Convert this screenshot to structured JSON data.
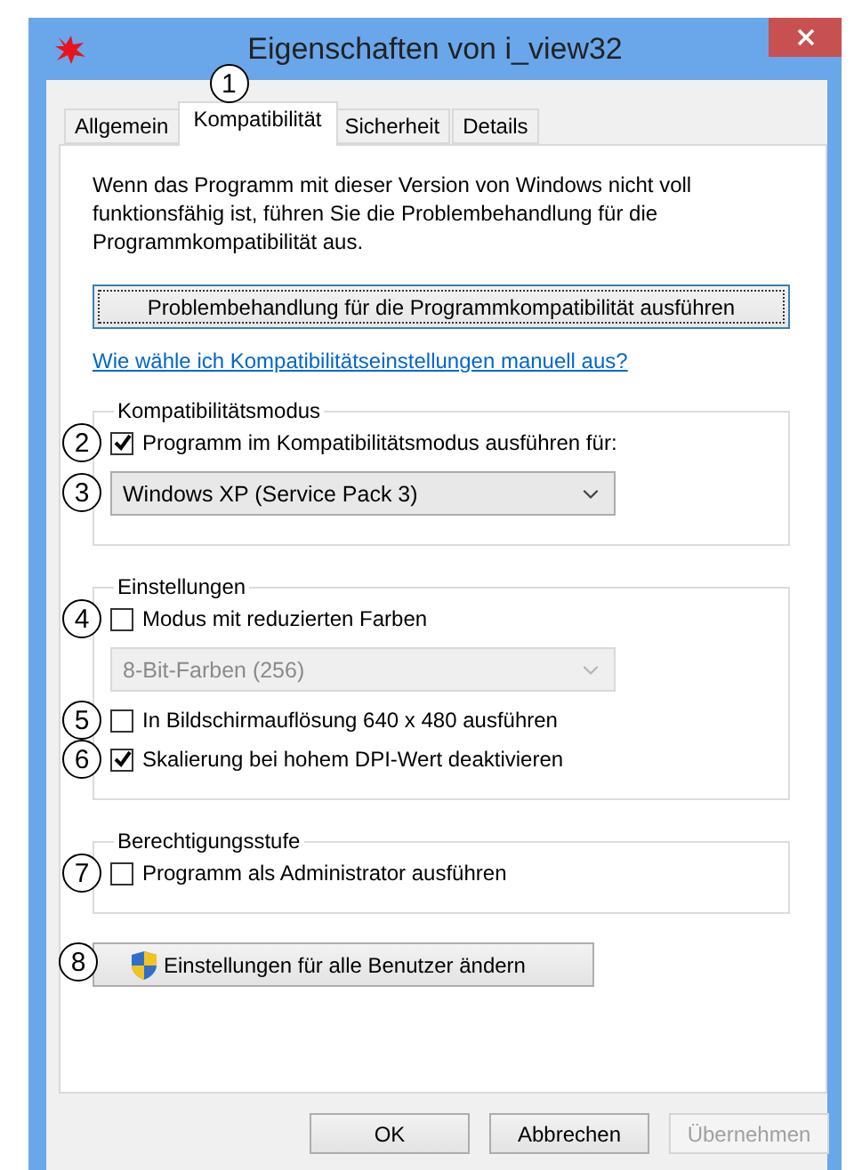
{
  "window": {
    "title": "Eigenschaften von i_view32"
  },
  "tabs": [
    {
      "label": "Allgemein",
      "selected": false
    },
    {
      "label": "Kompatibilität",
      "selected": true,
      "callout": "1"
    },
    {
      "label": "Sicherheit",
      "selected": false
    },
    {
      "label": "Details",
      "selected": false
    }
  ],
  "intro": "Wenn das Programm mit dieser Version von Windows nicht voll funktionsfähig ist, führen Sie die Problembehandlung für die Programmkompatibilität aus.",
  "troubleshoot_button": "Problembehandlung für die Programmkompatibilität ausführen",
  "help_link": "Wie wähle ich Kompatibilitätseinstellungen manuell aus?",
  "groups": [
    {
      "title": "Kompatibilitätsmodus",
      "items": [
        {
          "kind": "checkbox",
          "label": "Programm im Kompatibilitätsmodus ausführen für:",
          "checked": true,
          "callout": "2"
        },
        {
          "kind": "select",
          "value": "Windows XP (Service Pack 3)",
          "disabled": false,
          "callout": "3"
        }
      ]
    },
    {
      "title": "Einstellungen",
      "items": [
        {
          "kind": "checkbox",
          "label": "Modus mit reduzierten Farben",
          "checked": false,
          "callout": "4"
        },
        {
          "kind": "select",
          "value": "8-Bit-Farben (256)",
          "disabled": true
        },
        {
          "kind": "checkbox",
          "label": "In Bildschirmauflösung 640 x 480 ausführen",
          "checked": false,
          "callout": "5"
        },
        {
          "kind": "checkbox",
          "label": "Skalierung bei hohem DPI-Wert deaktivieren",
          "checked": true,
          "callout": "6"
        }
      ]
    },
    {
      "title": "Berechtigungsstufe",
      "items": [
        {
          "kind": "checkbox",
          "label": "Programm als Administrator ausführen",
          "checked": false,
          "callout": "7"
        }
      ]
    }
  ],
  "all_users_button": {
    "label": "Einstellungen für alle Benutzer ändern",
    "callout": "8"
  },
  "buttons": [
    {
      "label": "OK",
      "disabled": false
    },
    {
      "label": "Abbrechen",
      "disabled": false
    },
    {
      "label": "Übernehmen",
      "disabled": true
    }
  ]
}
